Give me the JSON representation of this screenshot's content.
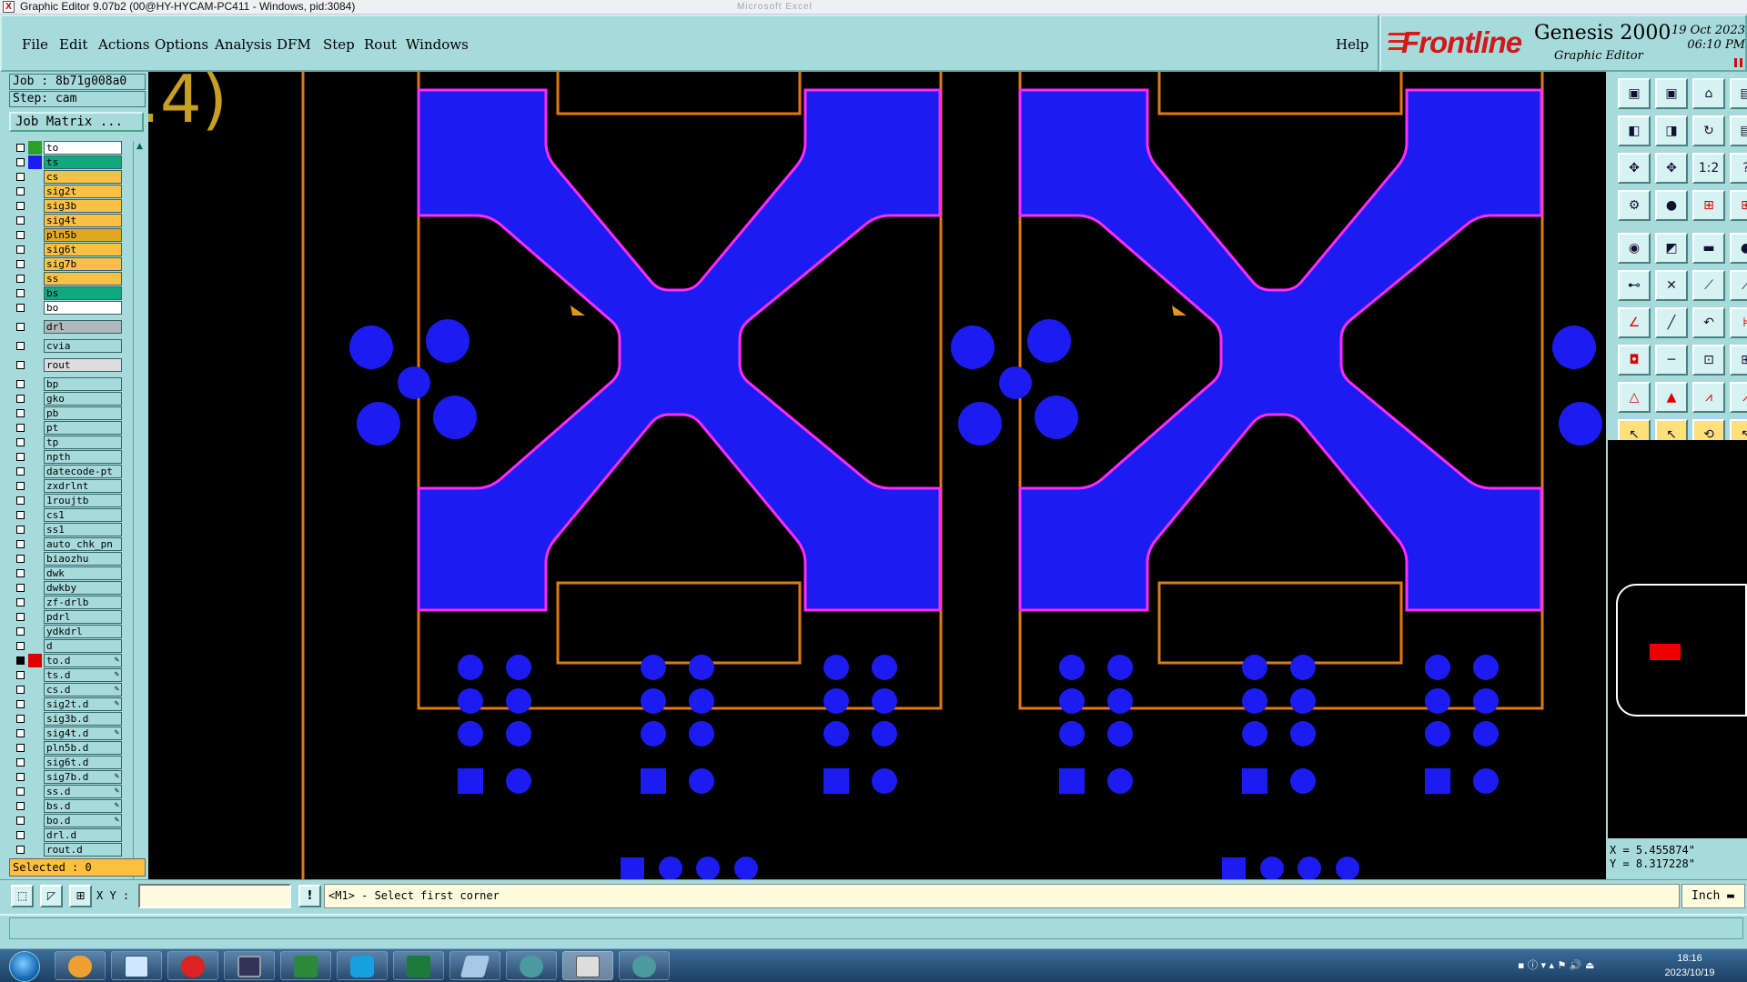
{
  "window": {
    "title": "Graphic Editor 9.07b2 (00@HY-HYCAM-PC411 - Windows, pid:3084)",
    "ghost_text": "Microsoft Excel"
  },
  "menu": [
    "File",
    "Edit",
    "Actions",
    "Options",
    "Analysis",
    "DFM",
    "Step",
    "Rout",
    "Windows"
  ],
  "help_label": "Help",
  "brand": {
    "logo": "Frontline",
    "product": "Genesis 2000",
    "subtitle": "Graphic Editor",
    "date": "19 Oct 2023",
    "time": "06:10 PM"
  },
  "job": {
    "job_label": "Job : 8b71g008a0",
    "step_label": "Step: cam",
    "matrix_button": "Job Matrix ..."
  },
  "layers": [
    {
      "name": "to",
      "color": "#2aa02a",
      "bg": "#ffffff"
    },
    {
      "name": "ts",
      "color": "#1c1cf0",
      "bg": "#12a87e"
    },
    {
      "name": "cs",
      "color": "",
      "bg": "#f8c045"
    },
    {
      "name": "sig2t",
      "color": "",
      "bg": "#f8c045"
    },
    {
      "name": "sig3b",
      "color": "",
      "bg": "#f8c045"
    },
    {
      "name": "sig4t",
      "color": "",
      "bg": "#f8c045"
    },
    {
      "name": "pln5b",
      "color": "",
      "bg": "#e0a821"
    },
    {
      "name": "sig6t",
      "color": "",
      "bg": "#f8c045"
    },
    {
      "name": "sig7b",
      "color": "",
      "bg": "#f8c045"
    },
    {
      "name": "ss",
      "color": "",
      "bg": "#f8c045"
    },
    {
      "name": "bs",
      "color": "",
      "bg": "#12a87e"
    },
    {
      "name": "bo",
      "color": "",
      "bg": "#ffffff"
    },
    {
      "name": "drl",
      "color": "",
      "bg": "#b0b8bb",
      "gap": true
    },
    {
      "name": "cvia",
      "color": "",
      "bg": "#a7dadb",
      "gap": true
    },
    {
      "name": "rout",
      "color": "",
      "bg": "#dddddd",
      "gap": true
    },
    {
      "name": "bp",
      "color": "",
      "bg": "#a7dadb",
      "gap": true
    },
    {
      "name": "gko",
      "color": "",
      "bg": "#a7dadb"
    },
    {
      "name": "pb",
      "color": "",
      "bg": "#a7dadb"
    },
    {
      "name": "pt",
      "color": "",
      "bg": "#a7dadb"
    },
    {
      "name": "tp",
      "color": "",
      "bg": "#a7dadb"
    },
    {
      "name": "npth",
      "color": "",
      "bg": "#a7dadb"
    },
    {
      "name": "datecode-pt",
      "color": "",
      "bg": "#a7dadb"
    },
    {
      "name": "zxdrlnt",
      "color": "",
      "bg": "#a7dadb"
    },
    {
      "name": "1roujtb",
      "color": "",
      "bg": "#a7dadb"
    },
    {
      "name": "cs1",
      "color": "",
      "bg": "#a7dadb"
    },
    {
      "name": "ss1",
      "color": "",
      "bg": "#a7dadb"
    },
    {
      "name": "auto_chk_pn",
      "color": "",
      "bg": "#a7dadb"
    },
    {
      "name": "biaozhu",
      "color": "",
      "bg": "#a7dadb"
    },
    {
      "name": "dwk",
      "color": "",
      "bg": "#a7dadb"
    },
    {
      "name": "dwkby",
      "color": "",
      "bg": "#a7dadb"
    },
    {
      "name": "zf-drlb",
      "color": "",
      "bg": "#a7dadb"
    },
    {
      "name": "pdrl",
      "color": "",
      "bg": "#a7dadb"
    },
    {
      "name": "ydkdrl",
      "color": "",
      "bg": "#a7dadb"
    },
    {
      "name": "d",
      "color": "",
      "bg": "#a7dadb"
    },
    {
      "name": "to.d",
      "color": "#e00000",
      "bg": "#a7dadb",
      "pen": true,
      "active": true
    },
    {
      "name": "ts.d",
      "color": "",
      "bg": "#a7dadb",
      "pen": true
    },
    {
      "name": "cs.d",
      "color": "",
      "bg": "#a7dadb",
      "pen": true
    },
    {
      "name": "sig2t.d",
      "color": "",
      "bg": "#a7dadb",
      "pen": true
    },
    {
      "name": "sig3b.d",
      "color": "",
      "bg": "#a7dadb"
    },
    {
      "name": "sig4t.d",
      "color": "",
      "bg": "#a7dadb",
      "pen": true
    },
    {
      "name": "pln5b.d",
      "color": "",
      "bg": "#a7dadb"
    },
    {
      "name": "sig6t.d",
      "color": "",
      "bg": "#a7dadb"
    },
    {
      "name": "sig7b.d",
      "color": "",
      "bg": "#a7dadb",
      "pen": true
    },
    {
      "name": "ss.d",
      "color": "",
      "bg": "#a7dadb",
      "pen": true
    },
    {
      "name": "bs.d",
      "color": "",
      "bg": "#a7dadb",
      "pen": true
    },
    {
      "name": "bo.d",
      "color": "",
      "bg": "#a7dadb",
      "pen": true
    },
    {
      "name": "drl.d",
      "color": "",
      "bg": "#a7dadb"
    },
    {
      "name": "rout.d",
      "color": "",
      "bg": "#a7dadb"
    }
  ],
  "selected_label": "Selected : 0",
  "canvas": {
    "fragment_text": ".4)"
  },
  "xy_label": "X Y :",
  "xy_value": "",
  "prompt": "<M1> - Select first corner",
  "units": "Inch",
  "coords": {
    "x": "X = 5.455874\"",
    "y": "Y = 8.317228\""
  },
  "clock": {
    "time": "18:16",
    "date": "2023/10/19"
  },
  "colors": {
    "panel": "#a7dadb",
    "copper": "#1c1cf0",
    "outline": "#ff2bff",
    "profile": "#e07a10"
  }
}
